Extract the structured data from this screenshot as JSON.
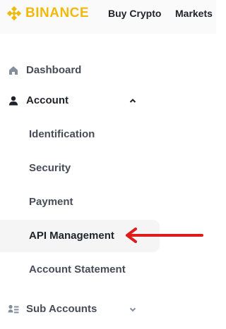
{
  "header": {
    "brand": "BINANCE",
    "nav": [
      "Buy Crypto",
      "Markets"
    ],
    "brand_color": "#f0b90b"
  },
  "sidebar": {
    "items": [
      {
        "label": "Dashboard",
        "icon": "home-icon"
      },
      {
        "label": "Account",
        "icon": "user-icon",
        "expanded": true
      },
      {
        "label": "Identification"
      },
      {
        "label": "Security"
      },
      {
        "label": "Payment"
      },
      {
        "label": "API Management",
        "active": true
      },
      {
        "label": "Account Statement"
      },
      {
        "label": "Sub Accounts",
        "icon": "sub-accounts-icon",
        "expanded": false
      }
    ]
  },
  "annotation": {
    "color": "#e01b1b",
    "icon": "red-arrow-icon"
  }
}
